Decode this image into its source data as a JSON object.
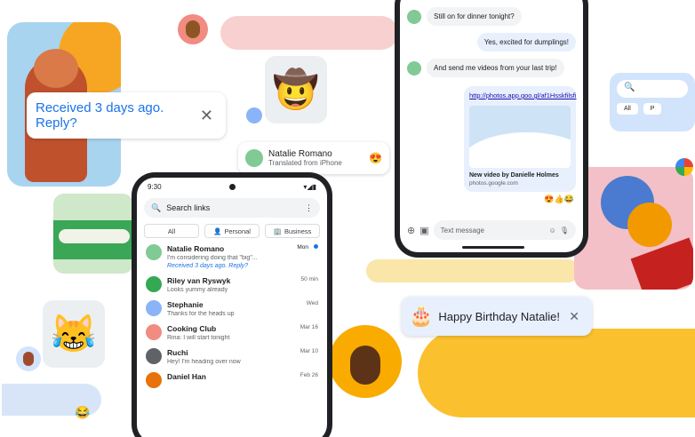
{
  "reply_card": {
    "text": "Received 3 days ago. Reply?",
    "close_icon": "✕"
  },
  "natalie_card": {
    "name": "Natalie Romano",
    "subtitle": "Translated from iPhone",
    "emoji": "😍"
  },
  "birthday_card": {
    "emoji": "🎂",
    "text": "Happy Birthday Natalie!",
    "close_icon": "✕"
  },
  "search_mini": {
    "search_icon": "🔍",
    "chips": [
      "All",
      "P"
    ]
  },
  "stickers": {
    "cowboy": "🤠",
    "cat": "😹",
    "reaction": "😂"
  },
  "main_phone": {
    "time": "9:30",
    "status_icons": "▾◢▮",
    "search_placeholder": "Search links",
    "menu_icon": "⋮",
    "filters": [
      {
        "label": "All",
        "icon": ""
      },
      {
        "label": "Personal",
        "icon": "👤"
      },
      {
        "label": "Business",
        "icon": "🏢"
      }
    ],
    "conversations": [
      {
        "name": "Natalie Romano",
        "time": "Mon",
        "message": "I'm considering doing that \"big\"...",
        "reply": "Received 3 days ago. Reply?",
        "avatar_color": "#81c995",
        "unread": true
      },
      {
        "name": "Riley van Ryswyk",
        "time": "50 min",
        "message": "Looks yummy already",
        "avatar_color": "#34a853"
      },
      {
        "name": "Stephanie",
        "time": "Wed",
        "message": "Thanks for the heads up",
        "avatar_color": "#8ab4f8"
      },
      {
        "name": "Cooking Club",
        "time": "Mar 16",
        "message": "Rina: I will start tonight",
        "avatar_color": "#f28b82"
      },
      {
        "name": "Ruchi",
        "time": "Mar 10",
        "message": "Hey! I'm heading over now",
        "avatar_color": "#5f6368"
      },
      {
        "name": "Daniel Han",
        "time": "Feb 26",
        "message": "",
        "avatar_color": "#e8710a"
      }
    ]
  },
  "top_phone": {
    "messages": [
      {
        "side": "in",
        "text": "Still on for dinner tonight?"
      },
      {
        "side": "out",
        "text": "Yes, excited for dumplings!"
      },
      {
        "side": "in",
        "text": "And send me videos from your last trip!"
      }
    ],
    "link": {
      "url": "http://photos.app.goo.gl/af1Hsskfilsfi",
      "title": "New video by Danielle Holmes",
      "domain": "photos.google.com"
    },
    "reactions": "😍👍😂",
    "compose_placeholder": "Text message",
    "add_icon": "⊕",
    "gallery_icon": "▣",
    "emoji_icon": "☺",
    "mic_icon": "🎙"
  },
  "colors": {
    "accent": "#1a73e8",
    "yellow": "#fbc02d",
    "pink": "#f8d0cf"
  }
}
